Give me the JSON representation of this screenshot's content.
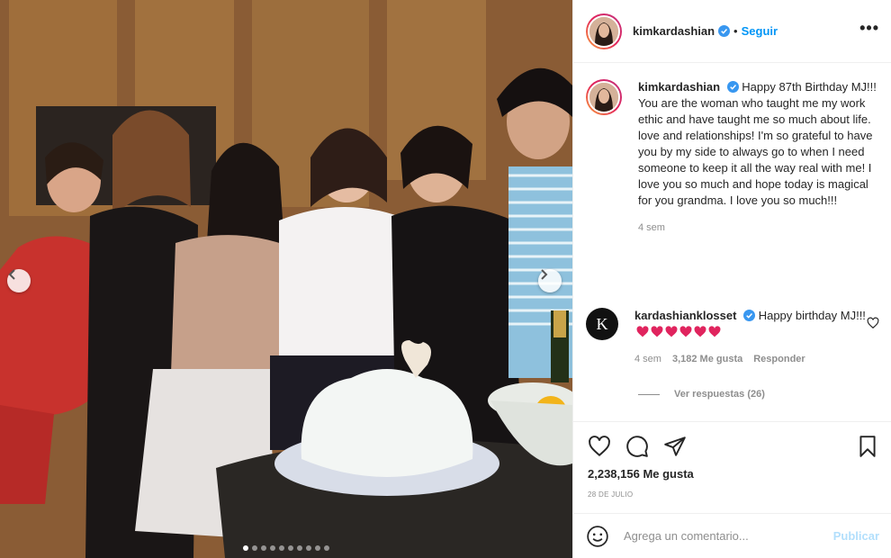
{
  "header": {
    "username": "kimkardashian",
    "separator": "•",
    "follow_label": "Seguir",
    "more_icon": "more-horizontal-icon"
  },
  "caption": {
    "username": "kimkardashian",
    "text": "Happy 87th Birthday MJ!!! You are the woman who taught me my work ethic and have taught me so much about life. love and relationships! I'm so grateful to have you by my side to always go to when I need someone to keep it all the way real with me! I love you so much and hope today is magical for you grandma. I love you so much!!!",
    "time": "4 sem"
  },
  "comment": {
    "username": "kardashianklosset",
    "avatar_letter": "K",
    "text": "Happy birthday MJ!!!",
    "time": "4 sem",
    "likes": "3,182 Me gusta",
    "reply_label": "Responder",
    "view_replies": "Ver respuestas (26)"
  },
  "post": {
    "likes": "2,238,156 Me gusta",
    "date": "28 DE JULIO"
  },
  "add_comment": {
    "placeholder": "Agrega un comentario...",
    "publish_label": "Publicar"
  },
  "carousel": {
    "total_slides": 10,
    "active_index": 0
  },
  "colors": {
    "accent": "#0095f6",
    "publish_disabled": "#b2dffc",
    "verified": "#3897f0",
    "heart_emoji": "#e0245e"
  }
}
